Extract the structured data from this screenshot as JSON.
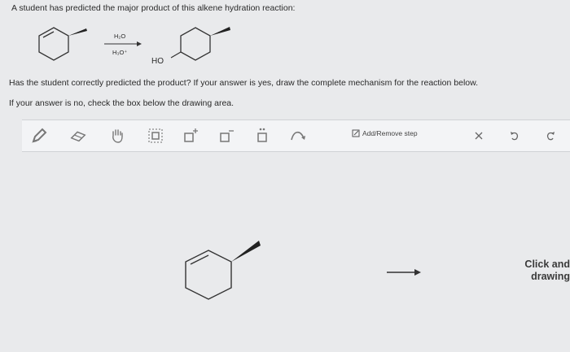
{
  "question": {
    "line1": "A student has predicted the major product of this alkene hydration reaction:",
    "line2": "Has the student correctly predicted the product? If your answer is yes, draw the complete mechanism for the reaction below.",
    "line3": "If your answer is no, check the box below the drawing area."
  },
  "reaction": {
    "reagent_top": "H₂O",
    "reagent_bottom": "H₃O⁺",
    "product_group": "HO"
  },
  "toolbar": {
    "tools": [
      "pencil-icon",
      "eraser-icon",
      "hand-icon",
      "box-select-icon",
      "positive-charge-icon",
      "negative-charge-icon",
      "lone-pair-icon",
      "curved-arrow-icon"
    ],
    "add_remove_step": "Add/Remove step",
    "right_tools": [
      "close-icon",
      "undo-icon",
      "redo-icon"
    ]
  },
  "canvas": {
    "hint_line1": "Click and",
    "hint_line2": "drawing"
  }
}
